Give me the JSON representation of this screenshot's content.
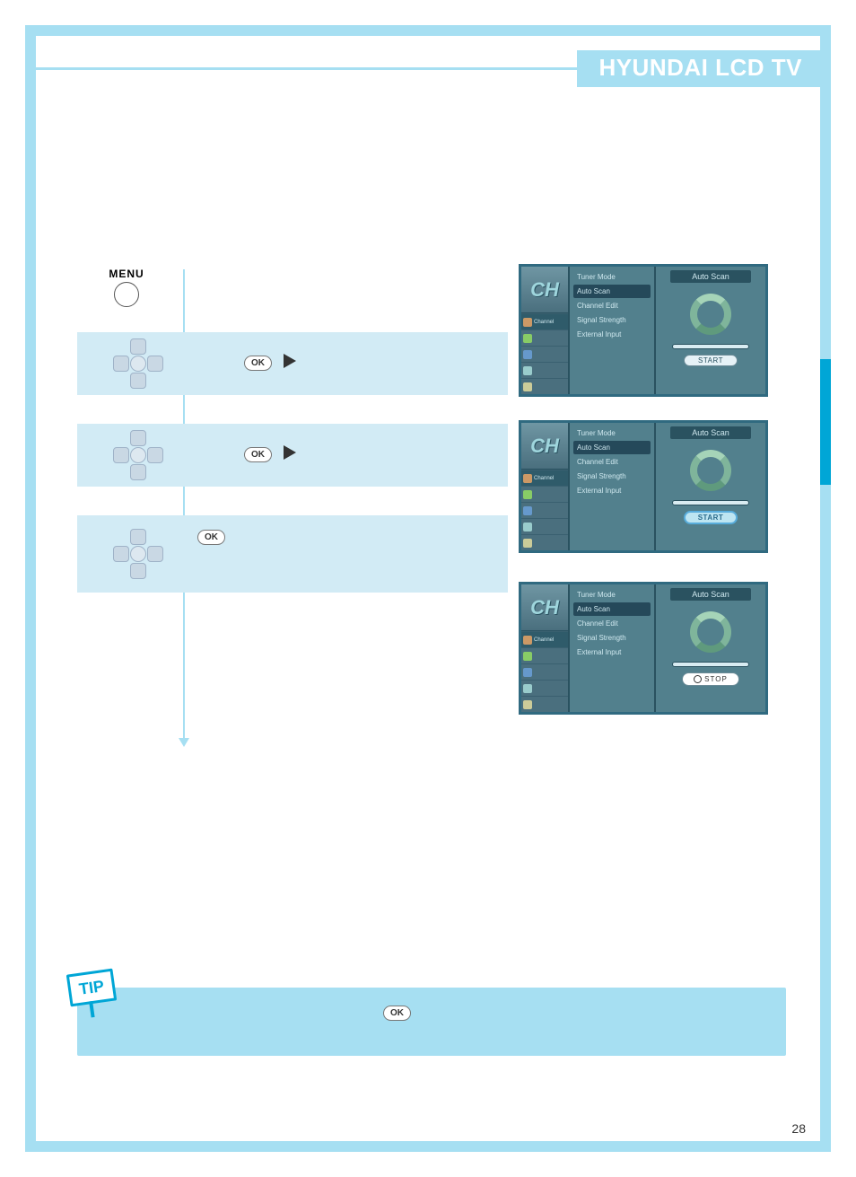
{
  "header": {
    "title": "HYUNDAI LCD TV"
  },
  "page_number": "28",
  "menu_button_label": "MENU",
  "ok_label": "OK",
  "tip_label": "TIP",
  "osd": {
    "logo": "CH",
    "right_title": "Auto Scan",
    "sidebar_active_label": "Channel",
    "start_label": "START",
    "stop_label": "STOP",
    "menu_items": [
      "Tuner Mode",
      "Auto Scan",
      "Channel Edit",
      "Signal Strength",
      "External Input"
    ],
    "selected_index_panel1": 1,
    "selected_index_panel2": 1,
    "selected_index_panel3": 1
  }
}
